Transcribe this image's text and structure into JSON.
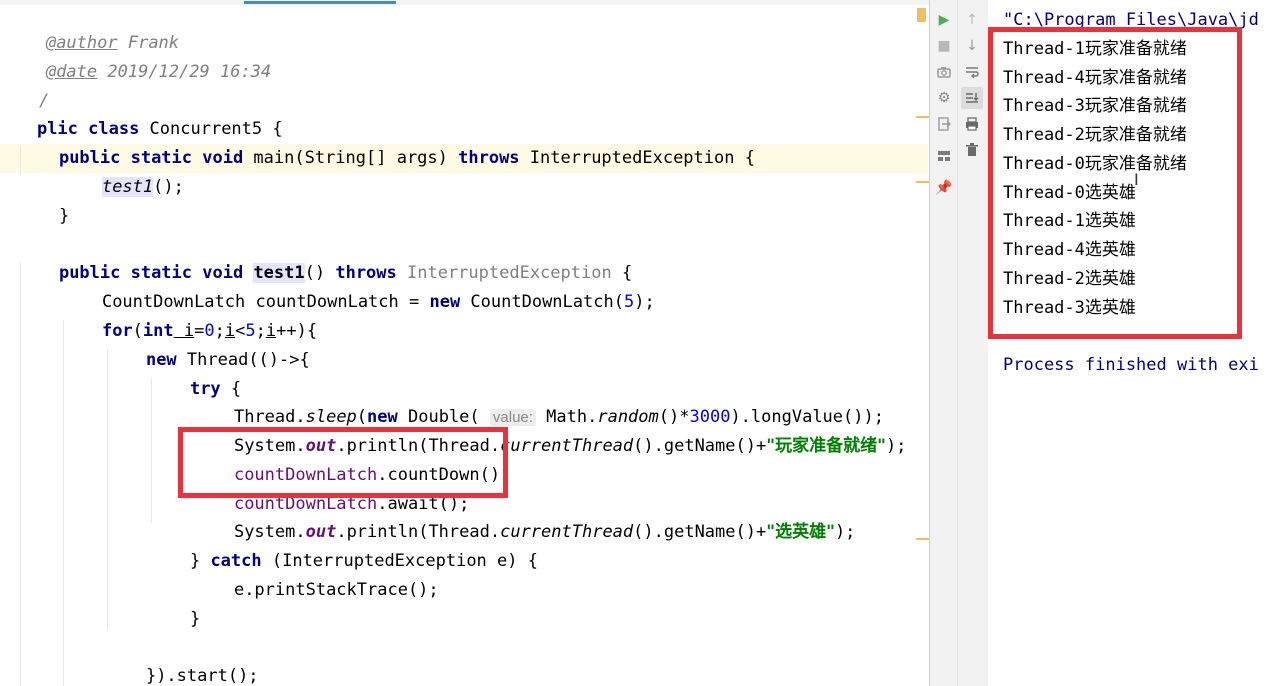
{
  "editor": {
    "lines": {
      "author_tag": "@author",
      "author_name": " Frank",
      "date_tag": "@date",
      "date_value": " 2019/12/29 16:34",
      "doc_end": "/",
      "class_kw": "plic class",
      "class_name": " Concurrent5 {",
      "main_kw": "public static void",
      "main_sig": " main(String[] args) ",
      "throws_kw": "throws",
      "main_exc": " InterruptedException {",
      "call_name": "test1",
      "call_tail": "();",
      "close_brace": "}",
      "test1_kw": "public static void",
      "test1_name": "test1",
      "test1_paren": "() ",
      "test1_throws": "throws",
      "test1_exc": " InterruptedException",
      "test1_open": " {",
      "latch_decl": "CountDownLatch countDownLatch = ",
      "new_kw": "new",
      "latch_ctor": " CountDownLatch(",
      "latch_num": "5",
      "latch_end": ");",
      "for_kw": "for",
      "for_open": "(",
      "int_kw": "int",
      "for_i": " i",
      "for_eq": "=",
      "for_zero": "0",
      "for_semi1": ";",
      "for_i2": "i",
      "for_lt": "<",
      "for_five": "5",
      "for_semi2": ";",
      "for_i3": "i",
      "for_inc": "++){",
      "thread_new": "new",
      "thread_rest": " Thread(()->{",
      "try_kw": "try",
      "try_open": " {",
      "sleep_a": "Thread.",
      "sleep_m": "sleep",
      "sleep_b": "(",
      "sleep_new": "new",
      "sleep_c": " Double( ",
      "sleep_hint": "value:",
      "sleep_d": " Math.",
      "sleep_random": "random",
      "sleep_e": "()*",
      "sleep_num": "3000",
      "sleep_f": ").longValue());",
      "print_a": "System.",
      "print_out": "out",
      "print_b": ".println(Thread.",
      "print_ct": "currentThread",
      "print_c": "().getName()+",
      "print_str1": "\"玩家准备就绪\"",
      "print_end": ");",
      "countdown_var": "countDownLatch",
      "countdown_call": ".countDown();",
      "await_var": "countDownLatch",
      "await_call": ".await();",
      "print2_str": "\"选英雄\"",
      "catch_open": "} ",
      "catch_kw": "catch",
      "catch_rest": " (InterruptedException e) {",
      "stack": "e.printStackTrace();",
      "inner_close": "}",
      "start": "}).start();",
      "outer_close": "}"
    }
  },
  "console": {
    "command": "\"C:\\Program Files\\Java\\jd",
    "output": [
      {
        "thread": "Thread-1",
        "msg": "玩家准备就绪"
      },
      {
        "thread": "Thread-4",
        "msg": "玩家准备就绪"
      },
      {
        "thread": "Thread-3",
        "msg": "玩家准备就绪"
      },
      {
        "thread": "Thread-2",
        "msg": "玩家准备就绪"
      },
      {
        "thread": "Thread-0",
        "msg": "玩家准备就绪"
      },
      {
        "thread": "Thread-0",
        "msg": "选英雄"
      },
      {
        "thread": "Thread-1",
        "msg": "选英雄"
      },
      {
        "thread": "Thread-4",
        "msg": "选英雄"
      },
      {
        "thread": "Thread-2",
        "msg": "选英雄"
      },
      {
        "thread": "Thread-3",
        "msg": "选英雄"
      }
    ],
    "process": "Process finished with exi"
  },
  "toolbar": {
    "icons": [
      "rerun-icon",
      "stop-icon",
      "camera-icon",
      "settings-icon",
      "exit-icon",
      "layout-icon",
      "pin-icon",
      "up-arrow-icon",
      "down-arrow-icon",
      "soft-wrap-icon",
      "scroll-to-end-icon",
      "print-icon",
      "trash-icon"
    ]
  },
  "colors": {
    "highlight_box": "#e8323c",
    "keyword": "#000080",
    "string": "#008000",
    "number": "#0000ff",
    "field": "#660e7a"
  }
}
